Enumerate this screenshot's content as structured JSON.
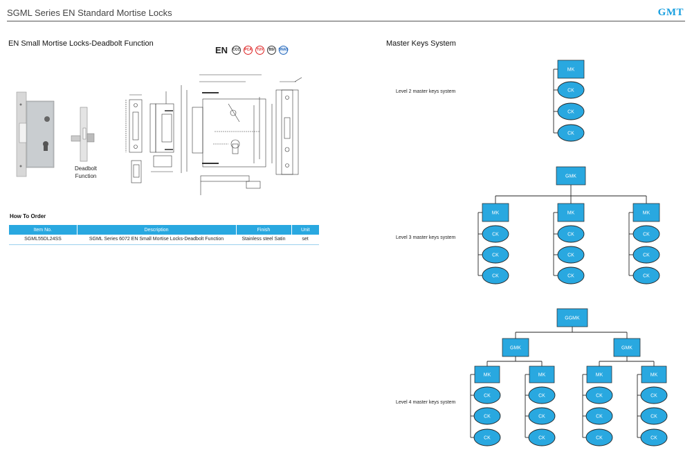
{
  "header": {
    "title": "SGML Series EN Standard Mortise Locks",
    "brand": "GMT"
  },
  "product": {
    "section_title": "EN Small Mortise Locks-Deadbolt Function",
    "label_line1": "Deadbolt",
    "label_line2": "Function",
    "certifications": {
      "en_mark": "EN",
      "badges": [
        "CCC",
        "PCA",
        "TUV",
        "BSI",
        "DNAS"
      ]
    }
  },
  "order": {
    "title": "How To Order",
    "columns": [
      "Item No.",
      "Description",
      "Finish",
      "Unit"
    ],
    "rows": [
      [
        "SGML55DL24SS",
        "SGML Series 6072 EN Small  Mortise Locks-Deadbolt Function",
        "Stainless steel Satin",
        "set"
      ]
    ]
  },
  "master_keys": {
    "section_title": "Master Keys System",
    "level2_label": "Level 2 master keys system",
    "level3_label": "Level 3 master keys system",
    "level4_label": "Level 4 master keys system",
    "labels": {
      "ggmk": "GGMK",
      "gmk": "GMK",
      "mk": "MK",
      "ck": "CK"
    },
    "node_color": "#29a8e0",
    "line_color": "#222222"
  }
}
